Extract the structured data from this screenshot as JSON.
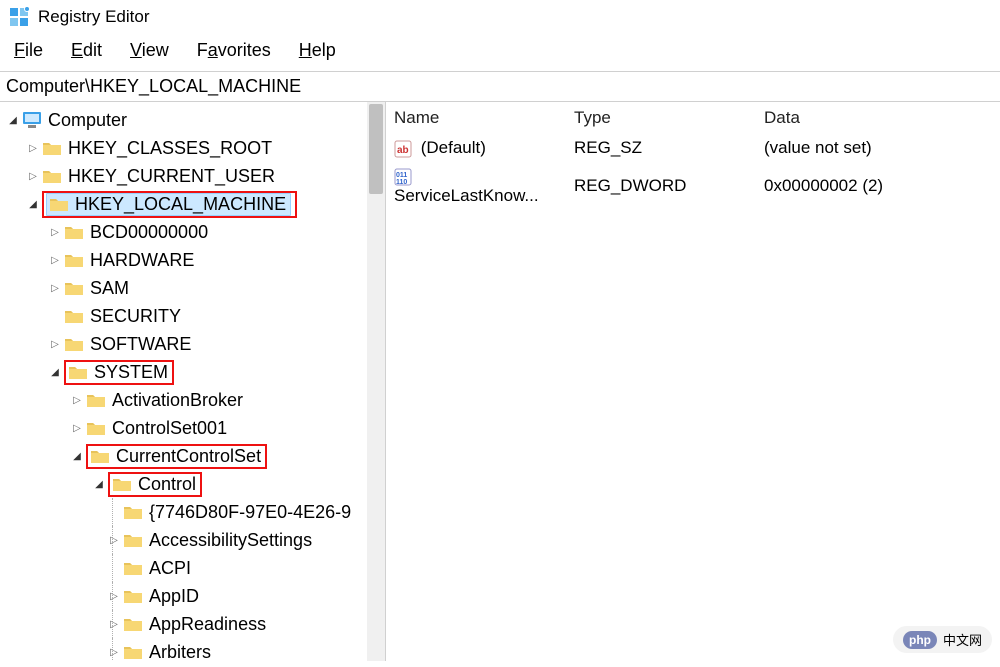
{
  "title": "Registry Editor",
  "menu": {
    "file": "File",
    "edit": "Edit",
    "view": "View",
    "favorites": "Favorites",
    "help": "Help"
  },
  "address": "Computer\\HKEY_LOCAL_MACHINE",
  "tree": {
    "root": "Computer",
    "hkcr": "HKEY_CLASSES_ROOT",
    "hkcu": "HKEY_CURRENT_USER",
    "hklm": "HKEY_LOCAL_MACHINE",
    "bcd": "BCD00000000",
    "hardware": "HARDWARE",
    "sam": "SAM",
    "security": "SECURITY",
    "software": "SOFTWARE",
    "system": "SYSTEM",
    "activationbroker": "ActivationBroker",
    "controlset001": "ControlSet001",
    "ccs": "CurrentControlSet",
    "control": "Control",
    "guid": "{7746D80F-97E0-4E26-9",
    "accessibility": "AccessibilitySettings",
    "acpi": "ACPI",
    "appid": "AppID",
    "appreadiness": "AppReadiness",
    "arbiters": "Arbiters"
  },
  "list": {
    "headers": {
      "name": "Name",
      "type": "Type",
      "data": "Data"
    },
    "rows": [
      {
        "name": "(Default)",
        "type": "REG_SZ",
        "data": "(value not set)",
        "iconType": "string"
      },
      {
        "name": "ServiceLastKnow...",
        "type": "REG_DWORD",
        "data": "0x00000002 (2)",
        "iconType": "binary"
      }
    ]
  },
  "watermark": {
    "badge": "php",
    "text": "中文网"
  }
}
